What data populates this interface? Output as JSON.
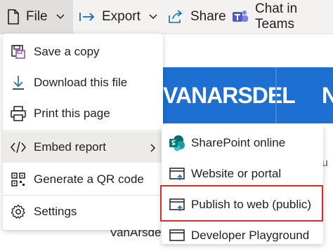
{
  "toolbar": {
    "file_label": "File",
    "export_label": "Export",
    "share_label": "Share",
    "teams_label": "Chat in Teams"
  },
  "report": {
    "banner_text": "VANARSDEL",
    "banner_letter": "N",
    "edge_text": "u",
    "bottom_text": "VanArsdel"
  },
  "file_menu": {
    "items": [
      {
        "label": "Save a copy",
        "icon": "save-copy-icon"
      },
      {
        "label": "Download this file",
        "icon": "download-icon"
      },
      {
        "label": "Print this page",
        "icon": "printer-icon"
      },
      {
        "label": "Embed report",
        "icon": "code-icon"
      },
      {
        "label": "Generate a QR code",
        "icon": "qr-code-icon"
      },
      {
        "label": "Settings",
        "icon": "gear-icon"
      }
    ]
  },
  "embed_submenu": {
    "items": [
      {
        "label": "SharePoint online",
        "icon": "sharepoint-icon"
      },
      {
        "label": "Website or portal",
        "icon": "website-icon"
      },
      {
        "label": "Publish to web (public)",
        "icon": "publish-web-icon"
      },
      {
        "label": "Developer Playground",
        "icon": "developer-icon"
      }
    ]
  },
  "colors": {
    "accent": "#1d6fd2",
    "highlight": "#d92c2c",
    "teams_purple": "#5059c9",
    "sharepoint_teal": "#038387",
    "icon_blue": "#0f6cbd"
  }
}
